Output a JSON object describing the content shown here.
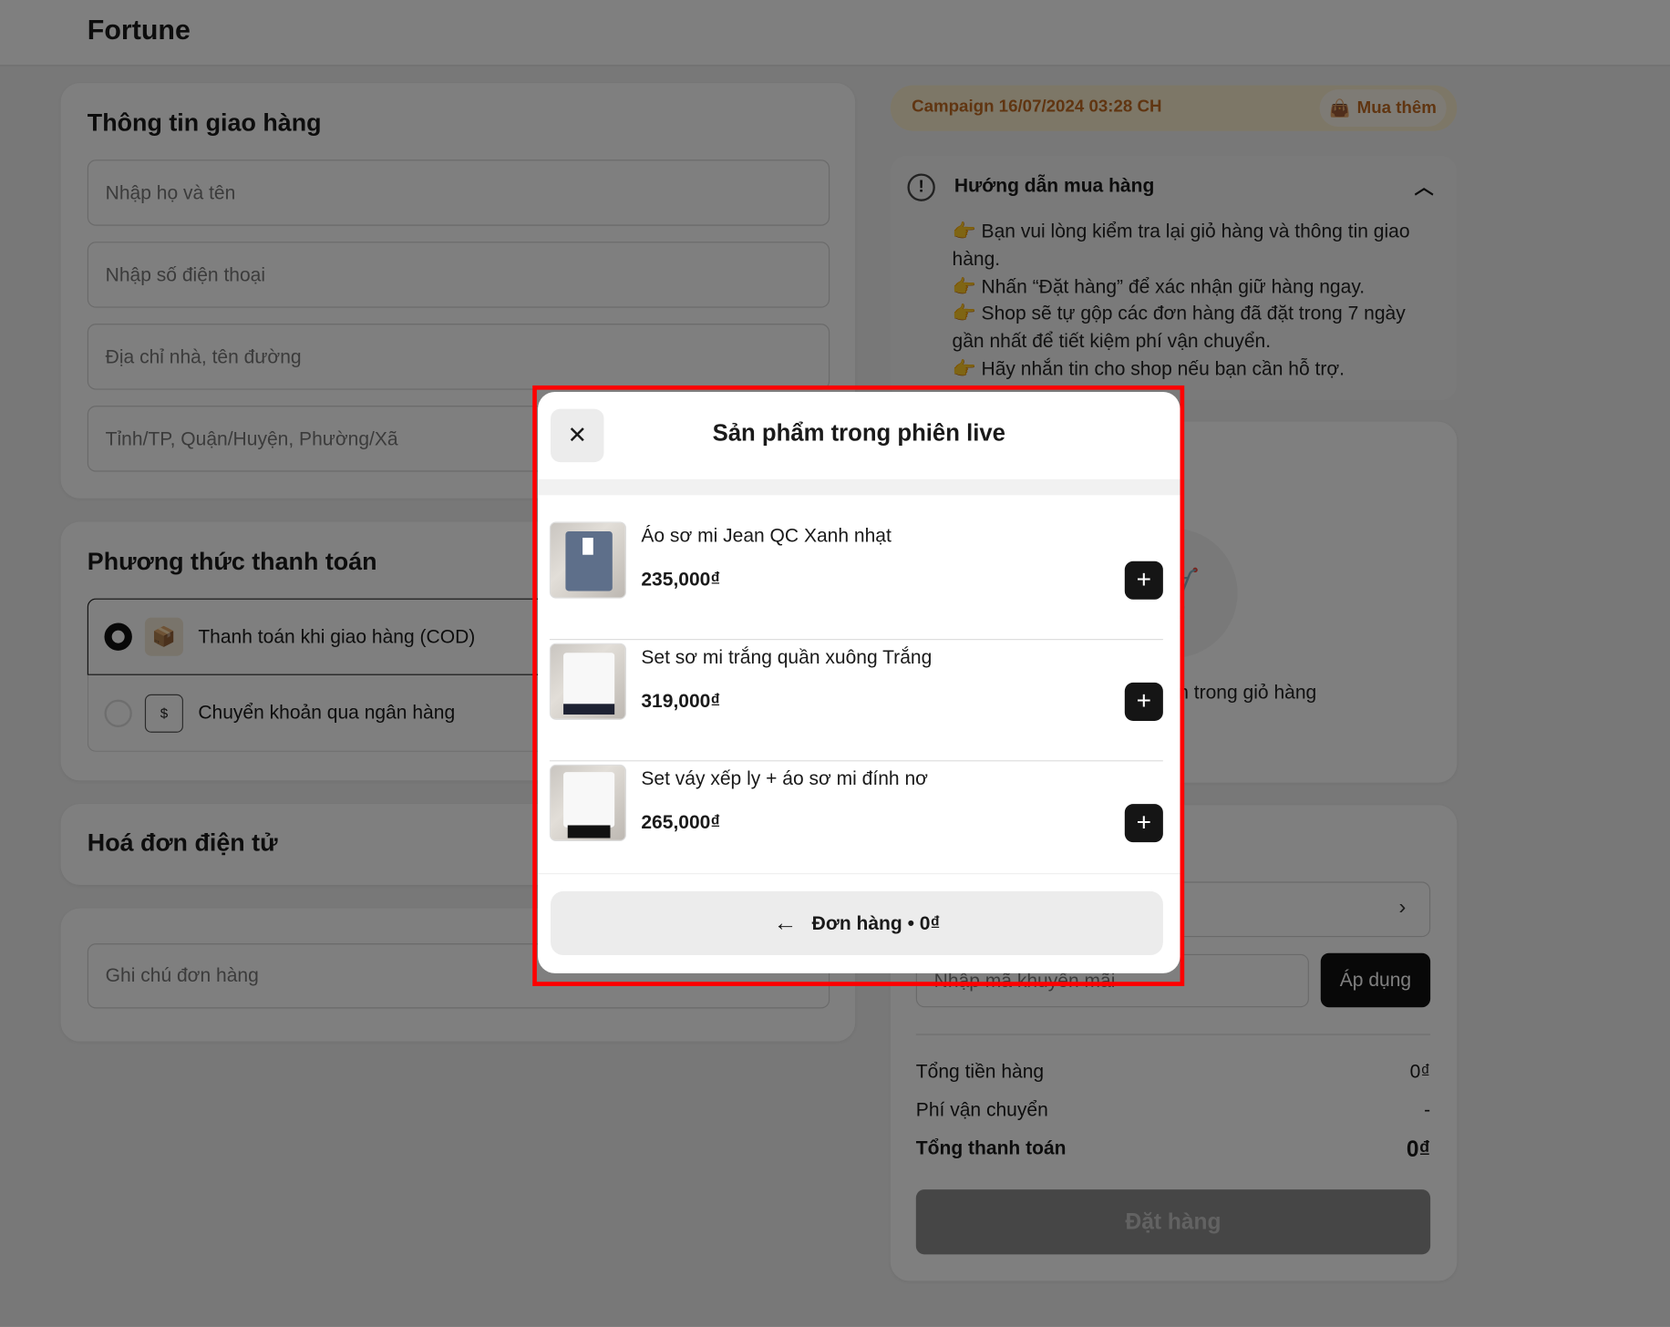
{
  "header": {
    "brand": "Fortune"
  },
  "shipping": {
    "title": "Thông tin giao hàng",
    "name_placeholder": "Nhập họ và tên",
    "phone_placeholder": "Nhập số điện thoại",
    "address_placeholder": "Địa chỉ nhà, tên đường",
    "region_placeholder": "Tỉnh/TP, Quận/Huyện, Phường/Xã"
  },
  "payment": {
    "title": "Phương thức thanh toán",
    "options": [
      {
        "label": "Thanh toán khi giao hàng (COD)",
        "selected": true
      },
      {
        "label": "Chuyển khoản qua ngân hàng",
        "selected": false
      }
    ]
  },
  "invoice": {
    "title": "Hoá đơn điện tử"
  },
  "note": {
    "placeholder": "Ghi chú đơn hàng"
  },
  "campaign": {
    "label": "Campaign 16/07/2024 03:28 CH",
    "buy_more": "Mua thêm"
  },
  "guide": {
    "title": "Hướng dẫn mua hàng",
    "lines": [
      "👉 Bạn vui lòng kiểm tra lại giỏ hàng và thông tin giao hàng.",
      "👉 Nhấn “Đặt hàng” để xác nhận giữ hàng ngay.",
      "👉 Shop sẽ tự gộp các đơn hàng đã đặt trong 7 ngày gần nhất để tiết kiệm phí vận chuyển.",
      "👉 Hãy nhắn tin cho shop nếu bạn cần hỗ trợ."
    ]
  },
  "cart": {
    "empty_text": "n trong giỏ hàng"
  },
  "summary": {
    "promo_placeholder": "Nhập mã khuyến mãi",
    "apply": "Áp dụng",
    "subtotal_label": "Tổng tiền hàng",
    "subtotal": "0₫",
    "shipping_label": "Phí vận chuyển",
    "shipping": "-",
    "total_label": "Tổng thanh toán",
    "total": "0₫",
    "order_button": "Đặt hàng"
  },
  "modal": {
    "title": "Sản phẩm trong phiên live",
    "items": [
      {
        "name": "Áo sơ mi Jean QC Xanh nhạt",
        "price": "235,000₫"
      },
      {
        "name": "Set sơ mi trắng quần xuông Trắng",
        "price": "319,000₫"
      },
      {
        "name": "Set váy xếp ly + áo sơ mi đính nơ",
        "price": "265,000₫"
      }
    ],
    "footer_button": "Đơn hàng • 0₫"
  },
  "colors": {
    "accent": "#c06a22",
    "highlight": "#ff0000"
  }
}
